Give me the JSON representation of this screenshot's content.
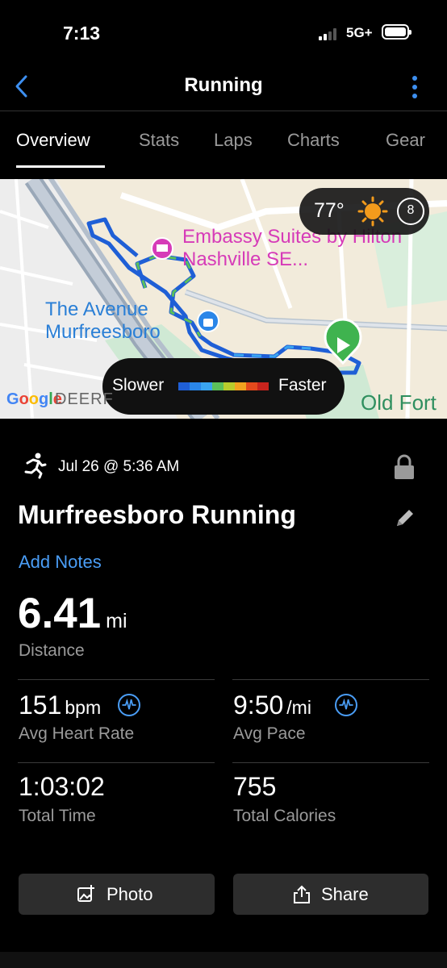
{
  "status_bar": {
    "time": "7:13",
    "network": "5G+"
  },
  "header": {
    "title": "Running"
  },
  "tabs": [
    "Overview",
    "Stats",
    "Laps",
    "Charts",
    "Gear"
  ],
  "map": {
    "weather_temp": "77°",
    "wind_speed": "8",
    "places": {
      "hotel": "Embassy Suites by Hilton Nashville SE...",
      "mall": "The Avenue Murfreesboro",
      "area": "Old Fort",
      "attribution": "Google",
      "street_partial": "DEERF"
    },
    "legend": {
      "slow": "Slower",
      "fast": "Faster"
    },
    "pace_colors": [
      "#1f5fd6",
      "#2a86e8",
      "#3aa5f0",
      "#5cc05a",
      "#b8cc2c",
      "#f2a21f",
      "#e44a1c",
      "#c8241d"
    ]
  },
  "activity": {
    "date": "Jul 26 @ 5:36 AM",
    "title": "Murfreesboro Running",
    "add_notes": "Add Notes",
    "distance": {
      "value": "6.41",
      "unit": "mi",
      "label": "Distance"
    },
    "stats": {
      "heart_rate": {
        "value": "151",
        "unit": "bpm",
        "label": "Avg Heart Rate"
      },
      "pace": {
        "value": "9:50",
        "unit": "/mi",
        "label": "Avg Pace"
      },
      "time": {
        "value": "1:03:02",
        "label": "Total Time"
      },
      "calories": {
        "value": "755",
        "label": "Total Calories"
      }
    }
  },
  "actions": {
    "photo": "Photo",
    "share": "Share"
  },
  "colors": {
    "accent": "#4a9df5",
    "hotel_pink": "#d63bb8",
    "start_green": "#3fb34f"
  }
}
